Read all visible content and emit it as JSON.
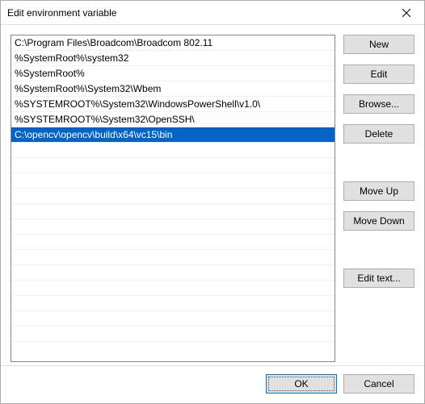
{
  "window": {
    "title": "Edit environment variable",
    "close_icon": "×"
  },
  "list": {
    "items": [
      {
        "text": "C:\\Program Files\\Broadcom\\Broadcom 802.11",
        "selected": false
      },
      {
        "text": "%SystemRoot%\\system32",
        "selected": false
      },
      {
        "text": "%SystemRoot%",
        "selected": false
      },
      {
        "text": "%SystemRoot%\\System32\\Wbem",
        "selected": false
      },
      {
        "text": "%SYSTEMROOT%\\System32\\WindowsPowerShell\\v1.0\\",
        "selected": false
      },
      {
        "text": "%SYSTEMROOT%\\System32\\OpenSSH\\",
        "selected": false
      },
      {
        "text": "C:\\opencv\\opencv\\build\\x64\\vc15\\bin",
        "selected": true
      }
    ],
    "visible_blank_rows": 14
  },
  "buttons": {
    "new": "New",
    "edit": "Edit",
    "browse": "Browse...",
    "delete": "Delete",
    "move_up": "Move Up",
    "move_down": "Move Down",
    "edit_text": "Edit text...",
    "ok": "OK",
    "cancel": "Cancel"
  }
}
